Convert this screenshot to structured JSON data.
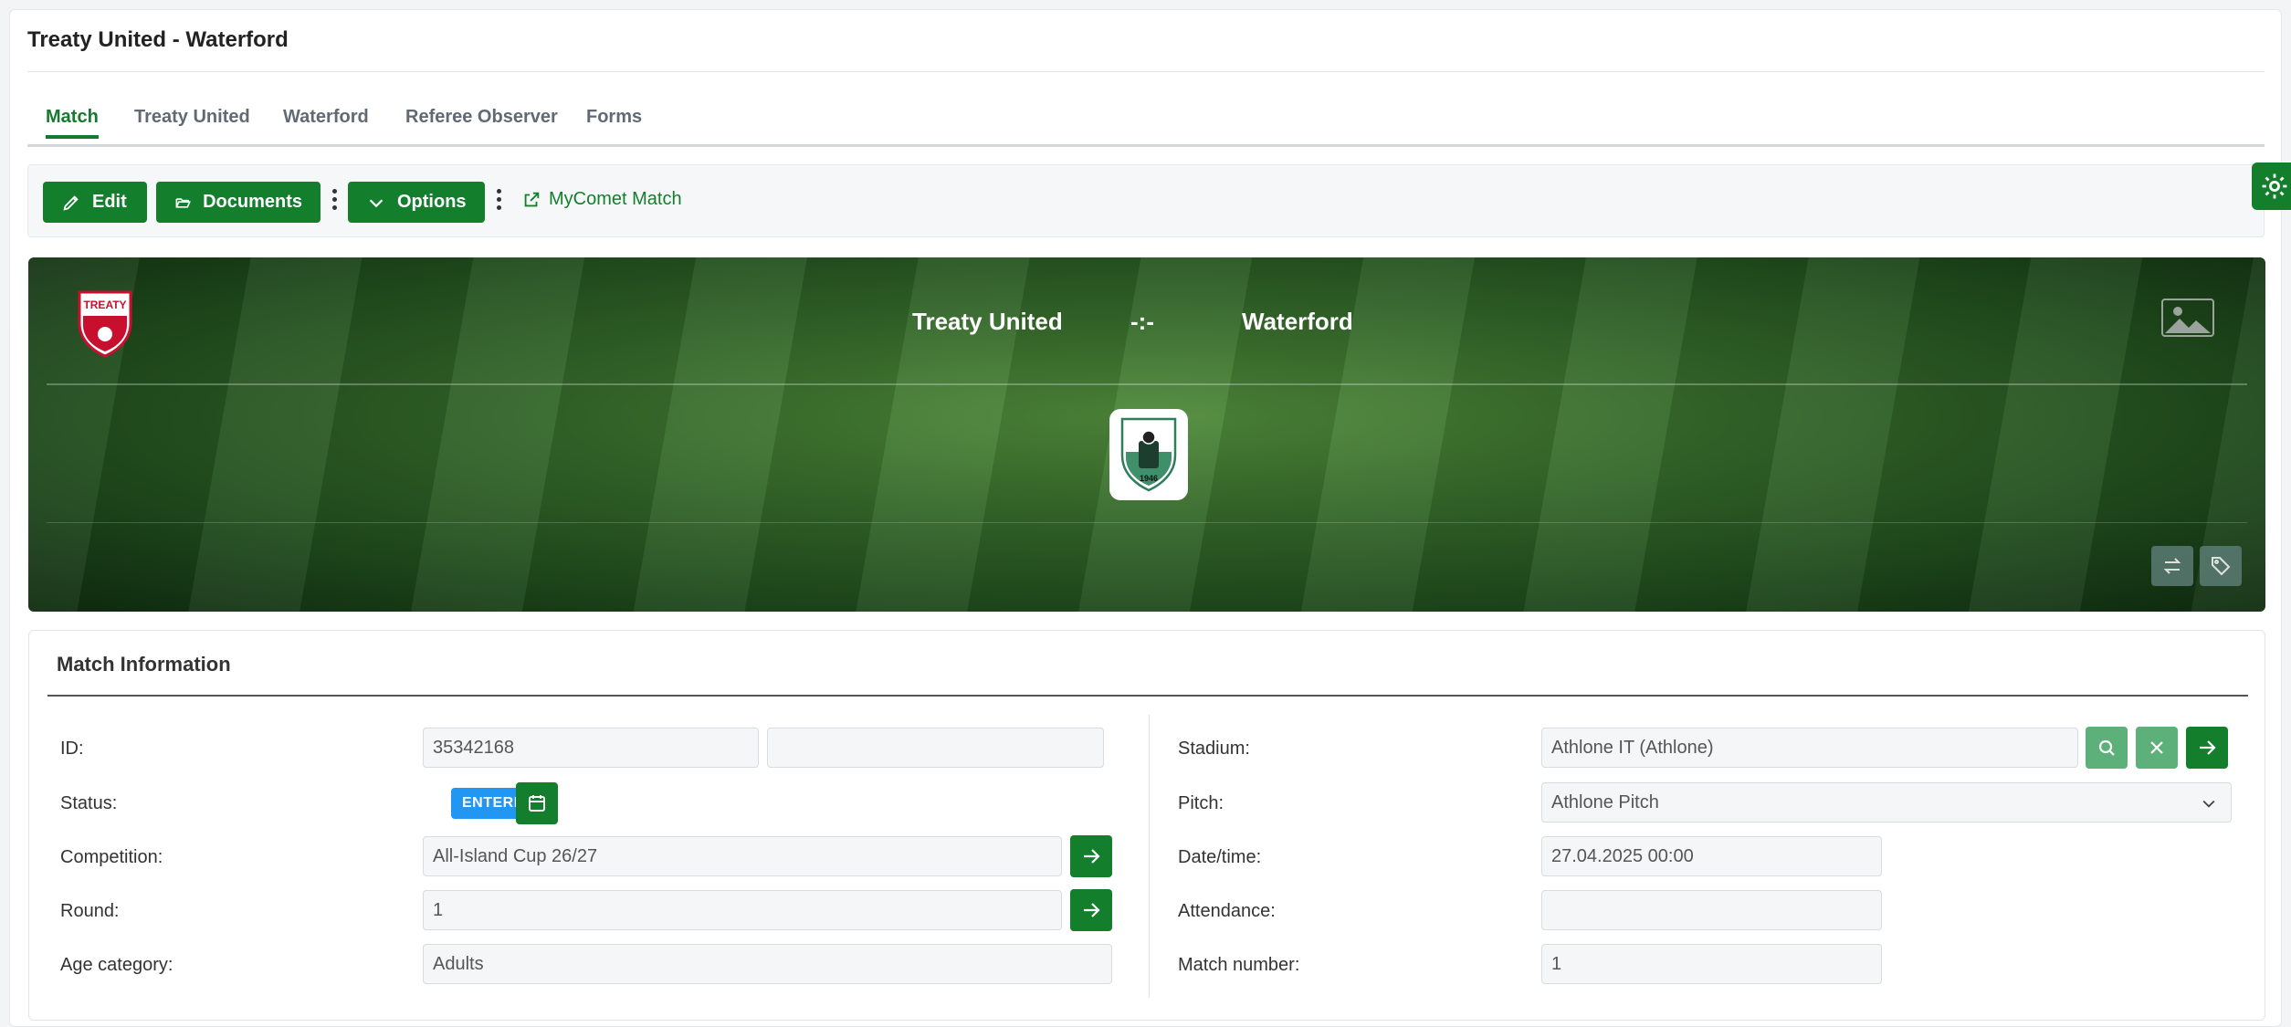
{
  "page": {
    "title": "Treaty United - Waterford"
  },
  "tabs": [
    {
      "label": "Match",
      "active": true
    },
    {
      "label": "Treaty United"
    },
    {
      "label": "Waterford"
    },
    {
      "label": "Referee Observer"
    },
    {
      "label": "Forms"
    }
  ],
  "toolbar": {
    "edit_label": "Edit",
    "documents_label": "Documents",
    "options_label": "Options",
    "mycomet_label": "MyComet Match"
  },
  "match": {
    "home_team": "Treaty United",
    "away_team": "Waterford",
    "score": "-:-",
    "home_logo_text": "TREATY",
    "badge_year": "1946"
  },
  "info": {
    "title": "Match Information",
    "left": {
      "id_label": "ID:",
      "id_value": "35342168",
      "id_value2": "",
      "status_label": "Status:",
      "status_value": "ENTERED",
      "competition_label": "Competition:",
      "competition_value": "All-Island Cup 26/27",
      "round_label": "Round:",
      "round_value": "1",
      "age_label": "Age category:",
      "age_value": "Adults"
    },
    "right": {
      "stadium_label": "Stadium:",
      "stadium_value": "Athlone IT (Athlone)",
      "pitch_label": "Pitch:",
      "pitch_value": "Athlone Pitch",
      "datetime_label": "Date/time:",
      "datetime_value": "27.04.2025 00:00",
      "attendance_label": "Attendance:",
      "attendance_value": "",
      "match_number_label": "Match number:",
      "match_number_value": "1"
    }
  },
  "colors": {
    "primary": "#137f2c",
    "status_badge": "#2196f3"
  }
}
